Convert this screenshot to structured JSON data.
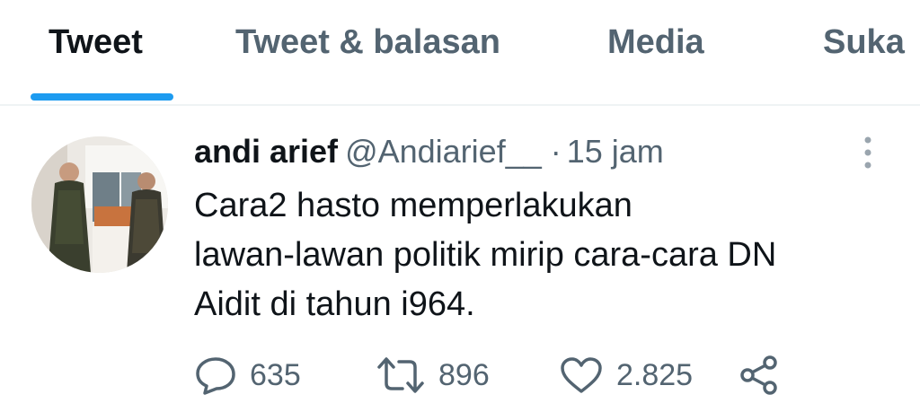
{
  "tabs": [
    {
      "label": "Tweet",
      "active": true
    },
    {
      "label": "Tweet & balasan",
      "active": false
    },
    {
      "label": "Media",
      "active": false
    },
    {
      "label": "Suka",
      "active": false
    }
  ],
  "tweet": {
    "author_name": "andi arief",
    "handle": "@Andiarief__",
    "separator": "·",
    "time": "15 jam",
    "text_lines": [
      "Cara2 hasto memperlakukan",
      "lawan-lawan politik mirip cara-cara DN",
      "Aidit di tahun i964."
    ],
    "avatar_icon": "profile-photo",
    "more_icon": "more-vertical-icon"
  },
  "actions": {
    "reply": {
      "icon": "reply-icon",
      "count": "635"
    },
    "retweet": {
      "icon": "retweet-icon",
      "count": "896"
    },
    "like": {
      "icon": "heart-icon",
      "count": "2.825"
    },
    "share": {
      "icon": "share-icon"
    }
  },
  "colors": {
    "accent": "#1d9bf0",
    "text_primary": "#0f1419",
    "text_secondary": "#536471",
    "divider": "#eff3f4"
  }
}
